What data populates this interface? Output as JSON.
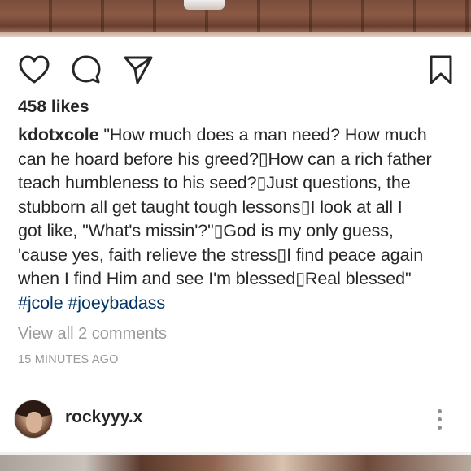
{
  "post": {
    "likes": "458 likes",
    "caption": {
      "username": "kdotxcole",
      "lines": [
        " \"How much does a man need? How much",
        "can he hoard before his greed?▯How can a rich father",
        "teach humbleness to his seed?▯Just questions, the",
        "stubborn all get taught tough lessons▯I look at all I",
        "got like, \"What's missin'?\"▯God is my only guess,",
        "'cause yes, faith relieve the stress▯I find peace again",
        "when I find Him and see I'm blessed▯Real blessed\""
      ],
      "hashtags": [
        "#jcole",
        "#joeybadass"
      ]
    },
    "view_comments": "View all 2 comments",
    "timestamp": "15 MINUTES AGO"
  },
  "actions": {
    "icons": [
      "heart-icon",
      "comment-icon",
      "share-icon",
      "bookmark-icon"
    ],
    "stroke_color": "#262626"
  },
  "next_post": {
    "username": "rockyyy.x"
  },
  "colors": {
    "text": "#262626",
    "muted": "#999999",
    "hashtag": "#003569"
  }
}
